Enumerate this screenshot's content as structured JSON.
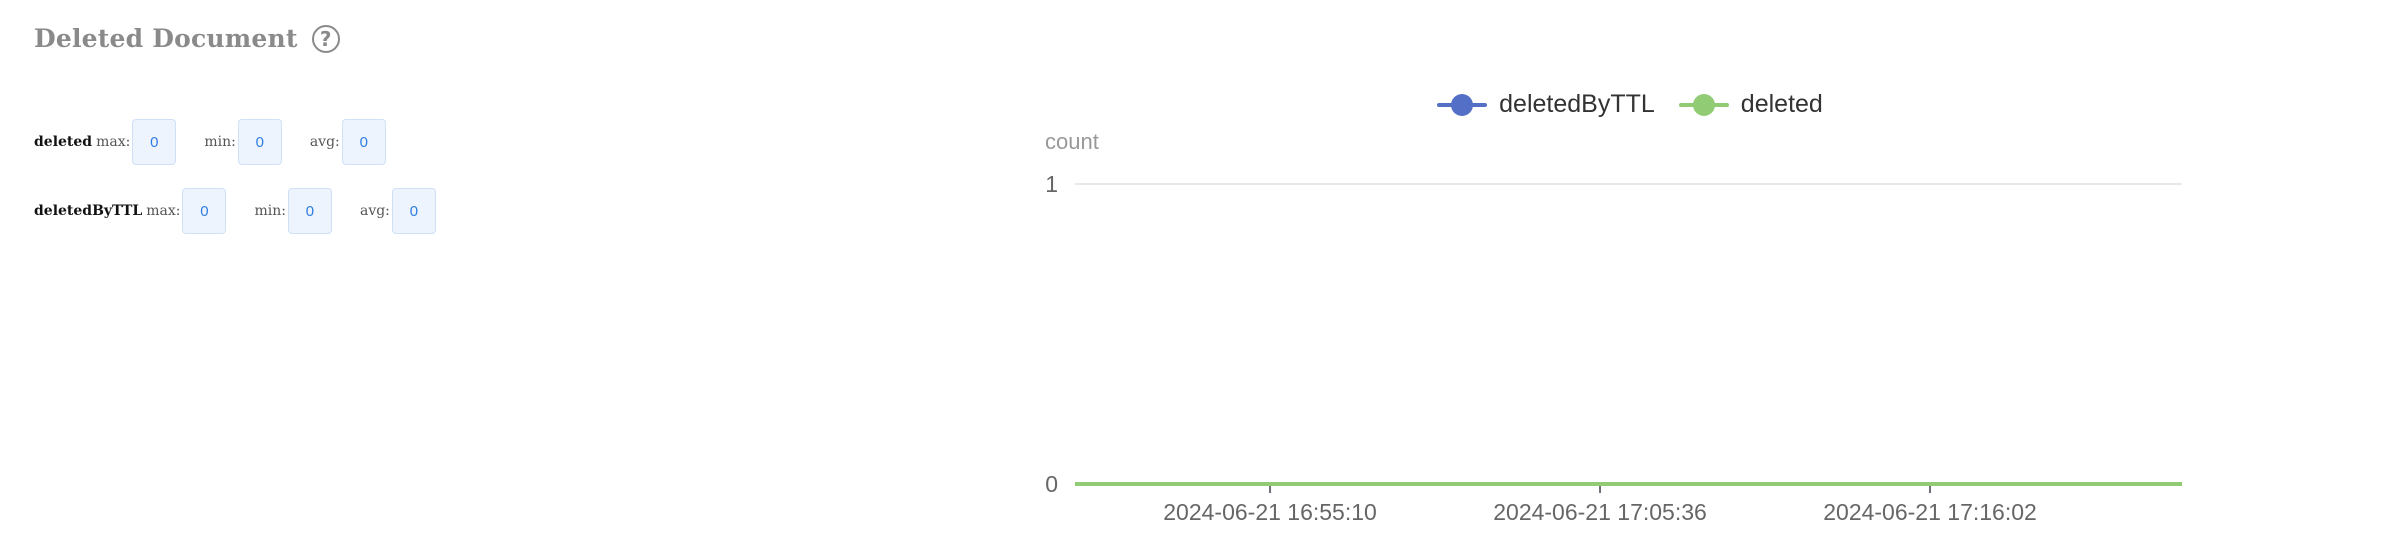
{
  "panel": {
    "title": "Deleted Document",
    "help_icon": "question-circle-icon"
  },
  "stats": [
    {
      "metric": "deleted",
      "max_label": "max:",
      "max": "0",
      "min_label": "min:",
      "min": "0",
      "avg_label": "avg:",
      "avg": "0"
    },
    {
      "metric": "deletedByTTL",
      "max_label": "max:",
      "max": "0",
      "min_label": "min:",
      "min": "0",
      "avg_label": "avg:",
      "avg": "0"
    }
  ],
  "chart_data": {
    "type": "line",
    "ylabel": "count",
    "ylim": [
      0,
      1
    ],
    "yticks": [
      "0",
      "1"
    ],
    "x_tick_labels": [
      "2024-06-21 16:55:10",
      "2024-06-21 17:05:36",
      "2024-06-21 17:16:02"
    ],
    "x_range": [
      "2024-06-21 16:49:00",
      "2024-06-21 17:24:00"
    ],
    "grid": true,
    "legend_position": "top-center",
    "series": [
      {
        "name": "deletedByTTL",
        "color": "#5470c6",
        "x": [
          "2024-06-21 16:49:00",
          "2024-06-21 17:24:00"
        ],
        "values": [
          0,
          0
        ]
      },
      {
        "name": "deleted",
        "color": "#91cc75",
        "x": [
          "2024-06-21 16:49:00",
          "2024-06-21 17:24:00"
        ],
        "values": [
          0,
          0
        ]
      }
    ]
  }
}
